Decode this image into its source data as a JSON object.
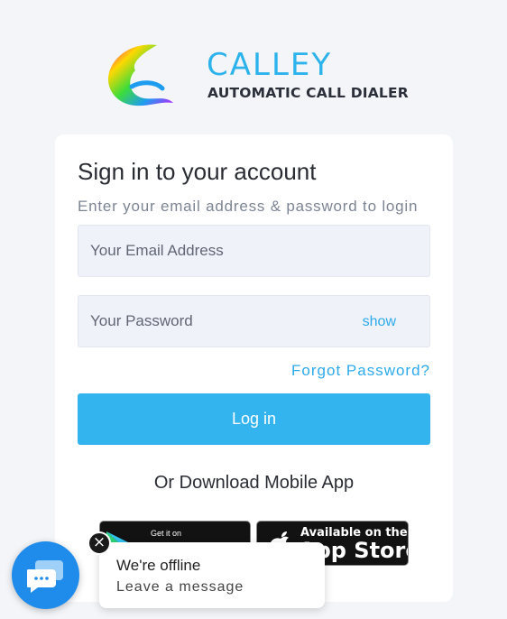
{
  "brand": {
    "name": "CALLEY",
    "tagline": "AUTOMATIC CALL DIALER"
  },
  "login": {
    "title": "Sign in to your account",
    "subtitle": "Enter your email address & password to login",
    "email_placeholder": "Your Email Address",
    "password_placeholder": "Your Password",
    "show_label": "show",
    "forgot_label": "Forgot Password?",
    "login_label": "Log in",
    "download_text": "Or Download Mobile App"
  },
  "stores": {
    "google_small": "Get it on",
    "apple_small": "Available on the",
    "apple_big": "App Store"
  },
  "chat": {
    "status": "We're offline",
    "action": "Leave a message",
    "close_glyph": "×"
  },
  "colors": {
    "accent": "#33b4ef",
    "chat": "#1f8ceb"
  }
}
